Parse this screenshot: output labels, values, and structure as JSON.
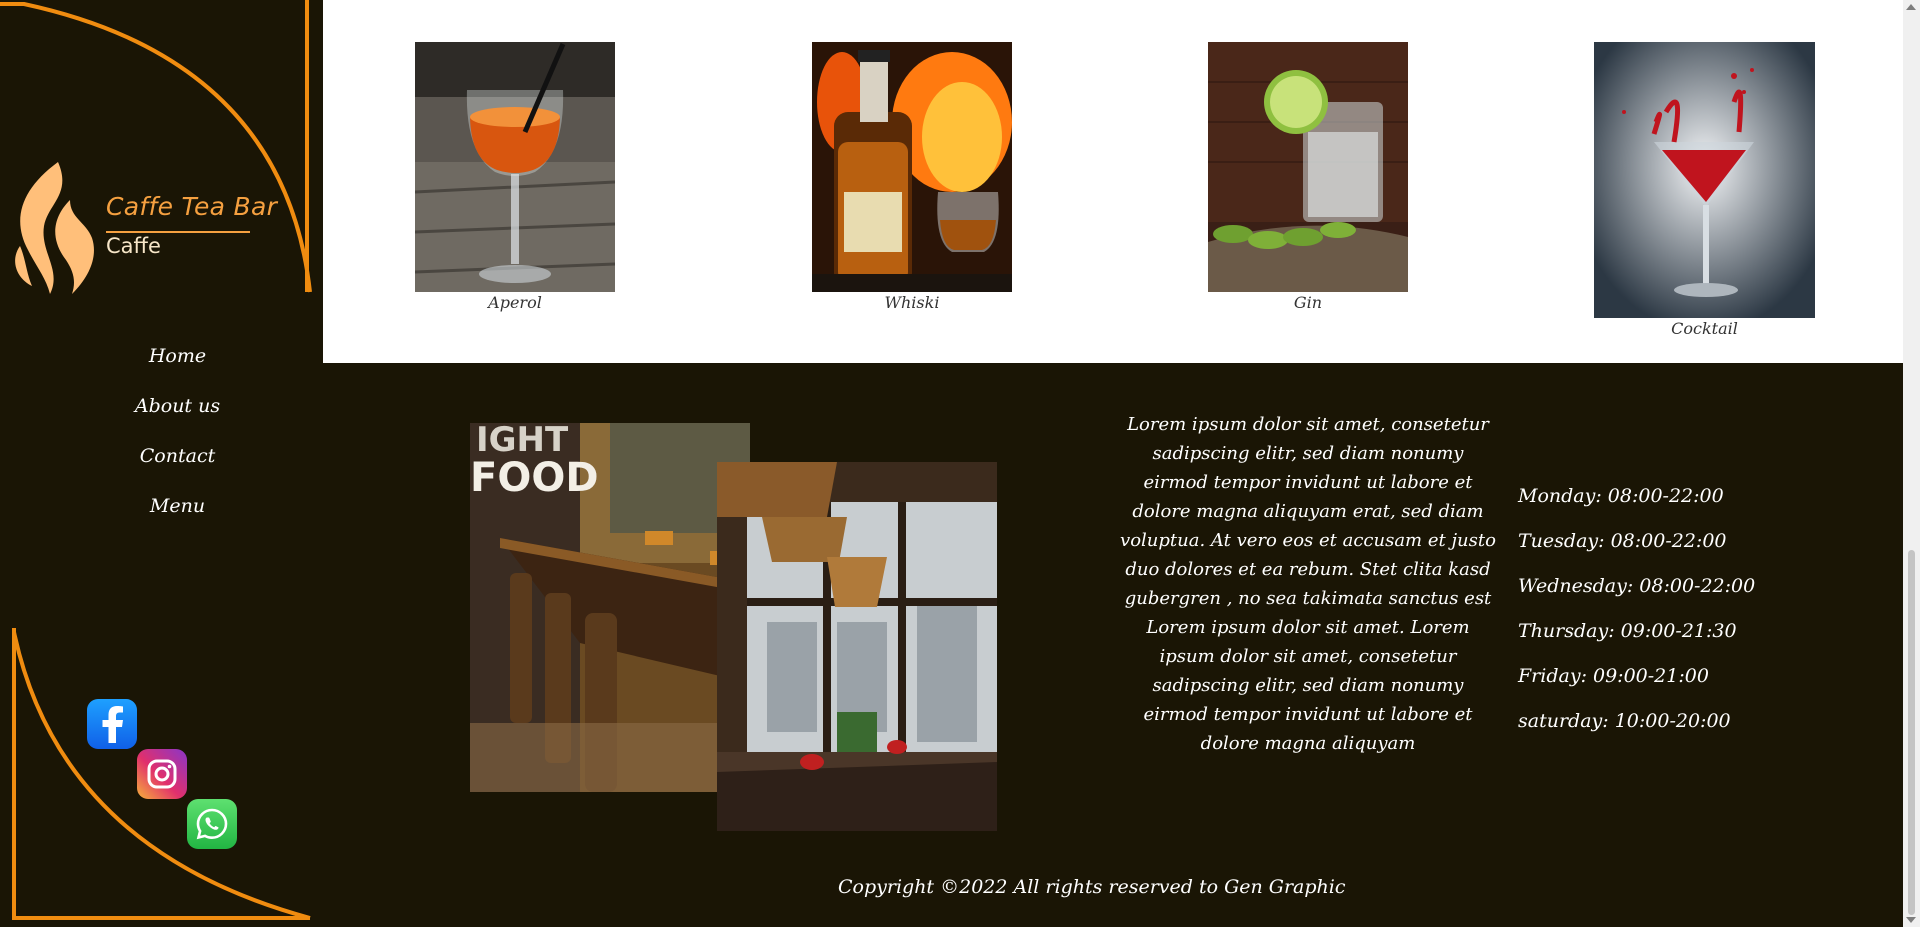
{
  "brand": {
    "title": "Caffe Tea Bar",
    "subtitle": "Caffe",
    "accent": "#f5a040",
    "frame_color": "#f08c10",
    "background": "#1a1505"
  },
  "nav": {
    "items": [
      "Home",
      "About us",
      "Contact",
      "Menu"
    ]
  },
  "social": [
    {
      "name": "facebook-icon",
      "color": "#1877f2"
    },
    {
      "name": "instagram-icon",
      "color": "#e1306c"
    },
    {
      "name": "whatsapp-icon",
      "color": "#25d366"
    }
  ],
  "drinks": [
    {
      "caption": "Aperol"
    },
    {
      "caption": "Whiski"
    },
    {
      "caption": "Gin"
    },
    {
      "caption": "Cocktail"
    }
  ],
  "about": {
    "text": "Lorem ipsum dolor sit amet, consetetur sadipscing elitr, sed diam nonumy eirmod tempor invidunt ut labore et dolore magna aliquyam erat, sed diam voluptua. At vero eos et accusam et justo duo dolores et ea rebum. Stet clita kasd gubergren , no sea takimata sanctus est Lorem ipsum dolor sit amet. Lorem ipsum dolor sit amet, consetetur sadipscing elitr, sed diam nonumy eirmod tempor invidunt ut labore et dolore magna aliquyam"
  },
  "hours": [
    "Monday: 08:00-22:00",
    "Tuesday: 08:00-22:00",
    "Wednesday: 08:00-22:00",
    "Thursday: 09:00-21:30",
    "Friday: 09:00-21:00",
    "saturday: 10:00-20:00"
  ],
  "footer": {
    "copyright": "Copyright ©2022 All rights reserved to Gen Graphic"
  }
}
